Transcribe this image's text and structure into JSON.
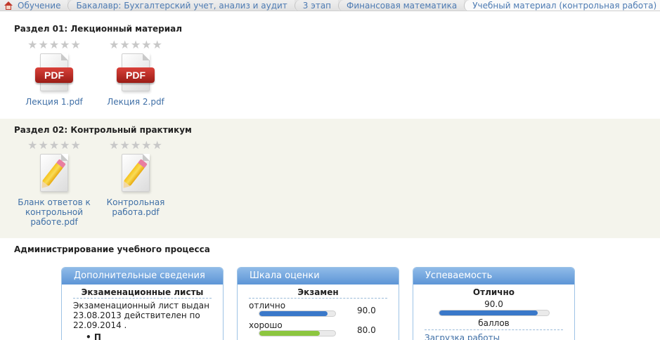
{
  "breadcrumb": [
    "Обучение",
    "Бакалавр: Бухгалтерский учет, анализ и аудит",
    "3 этап",
    "Финансовая математика",
    "Учебный материал (контрольная работа)"
  ],
  "sections": [
    {
      "title": "Раздел 01: Лекционный материал",
      "files": [
        {
          "name": "Лекция 1.pdf",
          "icon": "pdf-icon",
          "badge": "PDF"
        },
        {
          "name": "Лекция 2.pdf",
          "icon": "pdf-icon",
          "badge": "PDF"
        }
      ]
    },
    {
      "title": "Раздел 02: Контрольный практикум",
      "files": [
        {
          "name": "Бланк ответов к контрольной работе.pdf",
          "icon": "pencil-document-icon"
        },
        {
          "name": "Контрольная работа.pdf",
          "icon": "pencil-document-icon"
        }
      ]
    }
  ],
  "stars": "★★★★★",
  "admin": {
    "title": "Администрирование учебного процесса",
    "panels": {
      "info": {
        "header": "Дополнительные сведения",
        "subheader": "Экзаменационные листы",
        "text": "Экзаменационный лист выдан 23.08.2013 действителен по 22.09.2014 .",
        "extra": "•  П"
      },
      "scale": {
        "header": "Шкала оценки",
        "subheader": "Экзамен",
        "grades": [
          {
            "label": "отлично",
            "value": "90.0",
            "fill": 0.9,
            "color": "#3a78c9"
          },
          {
            "label": "хорошо",
            "value": "80.0",
            "fill": 0.8,
            "color": "#8cc63f"
          }
        ]
      },
      "progress": {
        "header": "Успеваемость",
        "grade": "Отлично",
        "value": "90.0",
        "fill": 0.9,
        "unit": "баллов",
        "link": "Загрузка работы"
      }
    }
  }
}
